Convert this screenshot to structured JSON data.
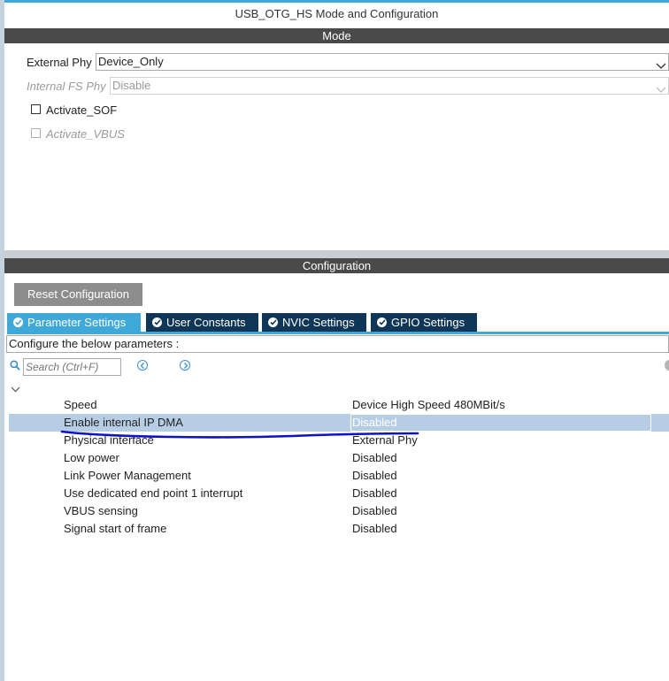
{
  "window_title": "USB_OTG_HS Mode and Configuration",
  "mode": {
    "header": "Mode",
    "external_phy": {
      "label": "External Phy",
      "value": "Device_Only"
    },
    "internal_fs_phy": {
      "label": "Internal FS Phy",
      "value": "Disable"
    },
    "activate_sof": {
      "label": "Activate_SOF",
      "checked": false
    },
    "activate_vbus": {
      "label": "Activate_VBUS",
      "checked": false
    }
  },
  "configuration": {
    "header": "Configuration",
    "reset_label": "Reset Configuration",
    "tabs": [
      {
        "label": "Parameter Settings",
        "active": true
      },
      {
        "label": "User Constants",
        "active": false
      },
      {
        "label": "NVIC Settings",
        "active": false
      },
      {
        "label": "GPIO Settings",
        "active": false
      }
    ],
    "configure_text": "Configure the below parameters :",
    "search_placeholder": "Search (Ctrl+F)",
    "parameters": [
      {
        "name": "Speed",
        "value": "Device High Speed 480MBit/s"
      },
      {
        "name": "Enable internal IP DMA",
        "value": "Disabled"
      },
      {
        "name": "Physical interface",
        "value": "External Phy"
      },
      {
        "name": "Low power",
        "value": "Disabled"
      },
      {
        "name": "Link Power Management",
        "value": "Disabled"
      },
      {
        "name": "Use dedicated end point 1 interrupt",
        "value": "Disabled"
      },
      {
        "name": "VBUS sensing",
        "value": "Disabled"
      },
      {
        "name": "Signal start of frame",
        "value": "Disabled"
      }
    ]
  },
  "colors": {
    "accent": "#3ea9d8",
    "tab_dark": "#0f3557",
    "section_bar": "#4a4a4a",
    "selected_row": "#b7cde4",
    "annotation_stroke": "#1010c8"
  },
  "icons": {
    "search": "search-icon",
    "prev": "arrow-left-circle-icon",
    "next": "arrow-right-circle-icon",
    "collapse": "chevron-down-icon",
    "tab_check": "check-circle-icon",
    "dropdown": "chevron-down-icon"
  }
}
